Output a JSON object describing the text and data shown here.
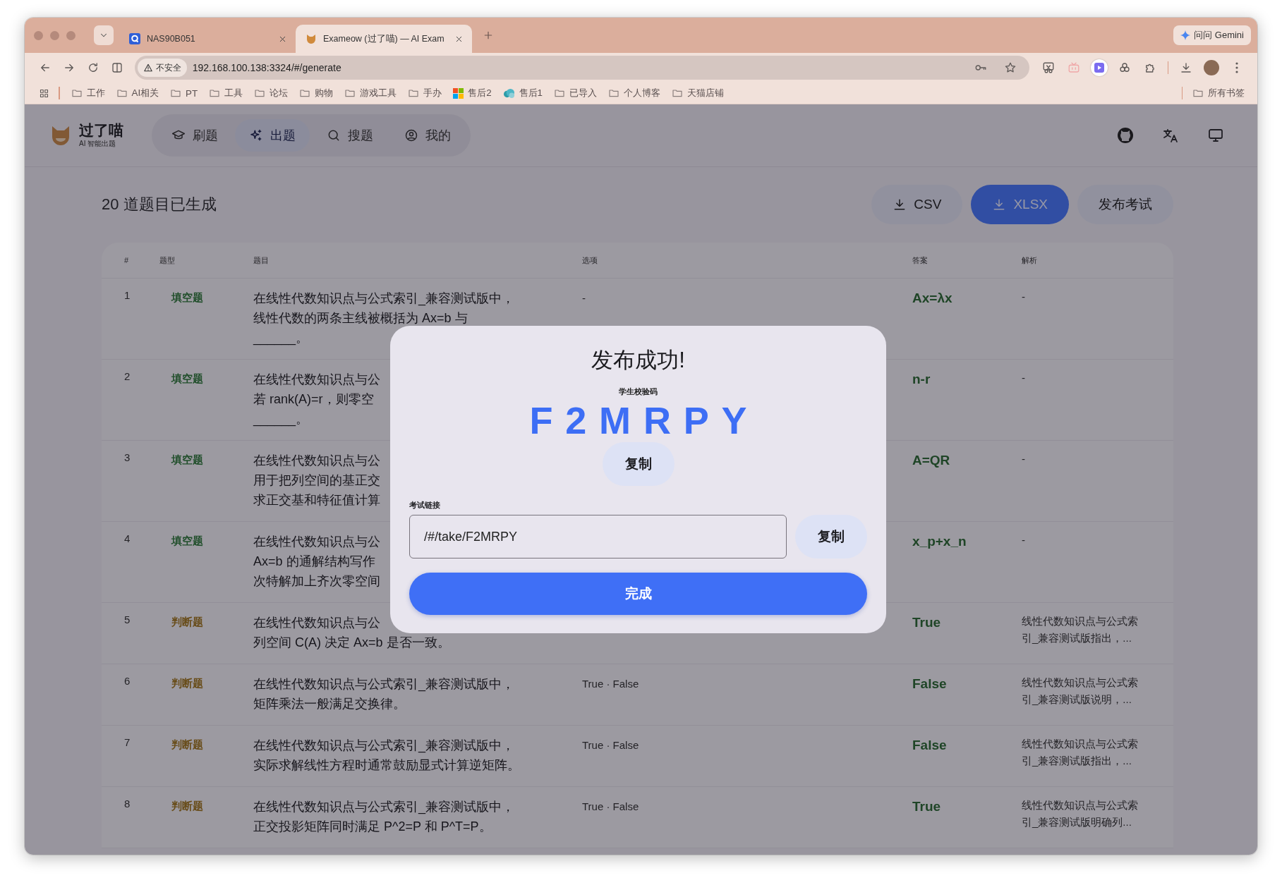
{
  "browser": {
    "tabs": [
      {
        "title": "NAS90B051",
        "kind": "nas",
        "selected": false
      },
      {
        "title": "Exameow (过了喵) — AI Exam",
        "kind": "cat",
        "selected": true
      }
    ],
    "gemini_button": "问问 Gemini",
    "security_label": "不安全",
    "url": "192.168.100.138:3324/#/generate",
    "bookmarks": [
      {
        "label": "工作",
        "kind": "folder"
      },
      {
        "label": "AI相关",
        "kind": "folder"
      },
      {
        "label": "PT",
        "kind": "folder"
      },
      {
        "label": "工具",
        "kind": "folder"
      },
      {
        "label": "论坛",
        "kind": "folder"
      },
      {
        "label": "购物",
        "kind": "folder"
      },
      {
        "label": "游戏工具",
        "kind": "folder"
      },
      {
        "label": "手办",
        "kind": "folder"
      },
      {
        "label": "售后2",
        "kind": "grid"
      },
      {
        "label": "售后1",
        "kind": "cloud"
      },
      {
        "label": "已导入",
        "kind": "folder"
      },
      {
        "label": "个人博客",
        "kind": "folder"
      },
      {
        "label": "天猫店铺",
        "kind": "folder"
      }
    ],
    "all_bookmarks": "所有书签"
  },
  "app": {
    "logo_title": "过了喵",
    "logo_subtitle": "AI 智能出题",
    "nav": [
      {
        "label": "刷题",
        "selected": false
      },
      {
        "label": "出题",
        "selected": true
      },
      {
        "label": "搜题",
        "selected": false
      },
      {
        "label": "我的",
        "selected": false
      }
    ]
  },
  "heading": "20 道题目已生成",
  "actions": [
    {
      "label": "CSV",
      "kind": "download"
    },
    {
      "label": "XLSX",
      "kind": "download-primary"
    },
    {
      "label": "发布考试",
      "kind": "plain"
    }
  ],
  "table": {
    "columns": [
      "#",
      "题型",
      "题目",
      "选项",
      "答案",
      "解析"
    ],
    "rows": [
      {
        "number": "1",
        "type": "填空题",
        "kind": "fill",
        "question_lines": [
          "在线性代数知识点与公式索引_兼容测试版中，",
          "线性代数的两条主线被概括为 Ax=b 与",
          "______。"
        ],
        "options": "-",
        "answer": "Ax=λx",
        "analysis": "-"
      },
      {
        "number": "2",
        "type": "填空题",
        "kind": "fill",
        "question_lines": [
          "在线性代数知识点与公",
          "若 rank(A)=r，则零空",
          "______。"
        ],
        "answer": "n-r",
        "analysis": "-"
      },
      {
        "number": "3",
        "type": "填空题",
        "kind": "fill",
        "question_lines": [
          "在线性代数知识点与公",
          "用于把列空间的基正交",
          "求正交基和特征值计算"
        ],
        "answer": "A=QR",
        "analysis": "-"
      },
      {
        "number": "4",
        "type": "填空题",
        "kind": "fill",
        "question_lines": [
          "在线性代数知识点与公",
          "Ax=b 的通解结构写作",
          "次特解加上齐次零空间"
        ],
        "answer": "x_p+x_n",
        "analysis": "-"
      },
      {
        "number": "5",
        "type": "判断题",
        "kind": "judge",
        "question_lines": [
          "在线性代数知识点与公",
          "列空间 C(A) 决定 Ax=b 是否一致。"
        ],
        "answer": "True",
        "analysis": "线性代数知识点与公式索引_兼容测试版指出，..."
      },
      {
        "number": "6",
        "type": "判断题",
        "kind": "judge",
        "question_lines": [
          "在线性代数知识点与公式索引_兼容测试版中，",
          "矩阵乘法一般满足交换律。"
        ],
        "options": "True · False",
        "answer": "False",
        "analysis": "线性代数知识点与公式索引_兼容测试版说明，..."
      },
      {
        "number": "7",
        "type": "判断题",
        "kind": "judge",
        "question_lines": [
          "在线性代数知识点与公式索引_兼容测试版中，",
          "实际求解线性方程时通常鼓励显式计算逆矩阵。"
        ],
        "options": "True · False",
        "answer": "False",
        "analysis": "线性代数知识点与公式索引_兼容测试版指出，..."
      },
      {
        "number": "8",
        "type": "判断题",
        "kind": "judge",
        "question_lines": [
          "在线性代数知识点与公式索引_兼容测试版中，",
          "正交投影矩阵同时满足 P^2=P 和 P^T=P。"
        ],
        "options": "True · False",
        "answer": "True",
        "analysis": "线性代数知识点与公式索引_兼容测试版明确列..."
      }
    ]
  },
  "modal": {
    "title": "发布成功!",
    "code_label": "学生校验码",
    "code": "F2MRPY",
    "copy_code_button": "复制",
    "link_label": "考试链接",
    "link_value": "/#/take/F2MRPY",
    "copy_link_button": "复制",
    "done_button": "完成"
  }
}
